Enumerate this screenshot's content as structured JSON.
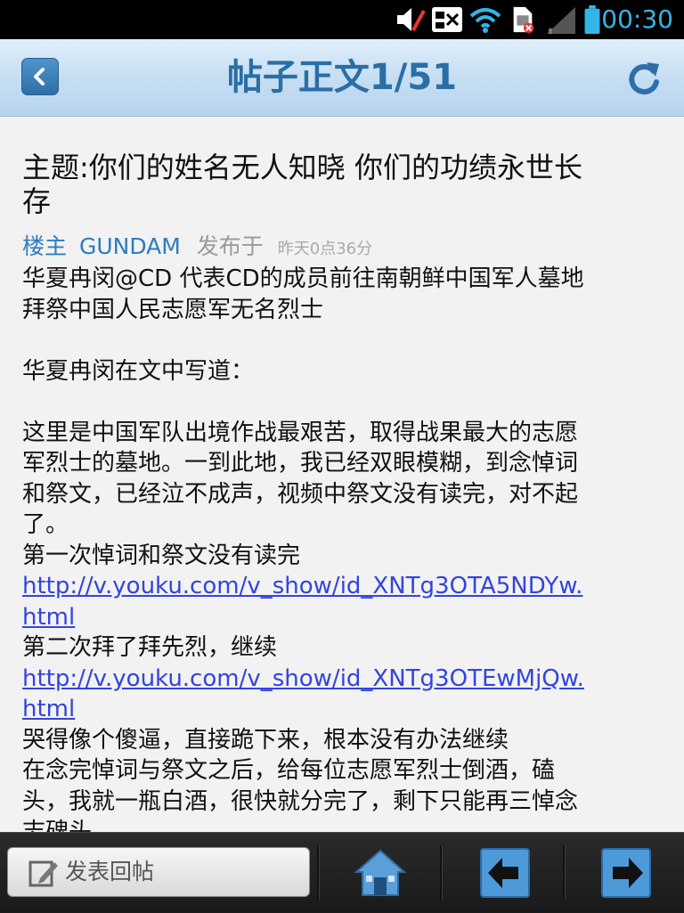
{
  "status_bar": {
    "time": "00:30",
    "icons": [
      "mute-icon",
      "gallery-icon",
      "wifi-icon",
      "sim-icon",
      "signal-icon",
      "battery-icon"
    ]
  },
  "header": {
    "title": "帖子正文1/51",
    "back_icon": "back-arrow-icon",
    "refresh_icon": "refresh-icon"
  },
  "post": {
    "subject_lines": [
      "主题:你们的姓名无人知晓 你们的功绩永世长",
      "存"
    ],
    "floor": "楼主",
    "author": "GUNDAM",
    "published_label": "发布于",
    "time": "昨天0点36分",
    "body": [
      {
        "type": "text",
        "text": "华夏冉闵@CD 代表CD的成员前往南朝鲜中国军人墓地"
      },
      {
        "type": "text",
        "text": "拜祭中国人民志愿军无名烈士"
      },
      {
        "type": "gap"
      },
      {
        "type": "text",
        "text": "华夏冉闵在文中写道："
      },
      {
        "type": "gap"
      },
      {
        "type": "text",
        "text": "这里是中国军队出境作战最艰苦，取得战果最大的志愿"
      },
      {
        "type": "text",
        "text": "军烈士的墓地。一到此地，我已经双眼模糊，到念悼词"
      },
      {
        "type": "text",
        "text": "和祭文，已经泣不成声，视频中祭文没有读完，对不起"
      },
      {
        "type": "text",
        "text": "了。"
      },
      {
        "type": "text",
        "text": "第一次悼词和祭文没有读完"
      },
      {
        "type": "link",
        "text": "http://v.youku.com/v_show/id_XNTg3OTA5NDYw."
      },
      {
        "type": "link",
        "text": "html"
      },
      {
        "type": "text",
        "text": "第二次拜了拜先烈，继续"
      },
      {
        "type": "link",
        "text": "http://v.youku.com/v_show/id_XNTg3OTEwMjQw."
      },
      {
        "type": "link",
        "text": "html"
      },
      {
        "type": "text",
        "text": "哭得像个傻逼，直接跪下来，根本没有办法继续"
      },
      {
        "type": "text",
        "text": "在念完悼词与祭文之后，给每位志愿军烈士倒酒，磕"
      },
      {
        "type": "text",
        "text": "头，我就一瓶白酒，很快就分完了，剩下只能再三悼念"
      },
      {
        "type": "text",
        "text": "志碑头"
      }
    ]
  },
  "bottom_bar": {
    "reply_label": "发表回帖",
    "reply_icon": "edit-icon",
    "home_icon": "home-icon",
    "prev_icon": "prev-arrow-icon",
    "next_icon": "next-arrow-icon"
  }
}
